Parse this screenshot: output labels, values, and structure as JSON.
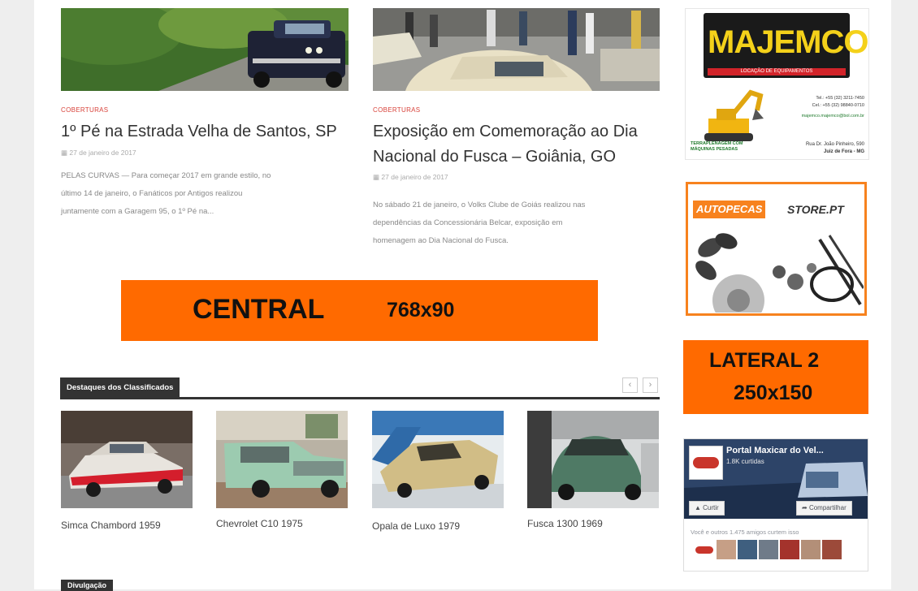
{
  "posts": [
    {
      "category": "COBERTURAS",
      "title": "1º Pé na Estrada Velha de Santos, SP",
      "date": "27 de janeiro de 2017",
      "excerpt_lines": [
        "PELAS CURVAS — Para começar 2017 em grande estilo, no",
        "último 14 de janeiro, o Fanáticos por Antigos realizou",
        "juntamente com a Garagem 95, o 1º Pé na..."
      ]
    },
    {
      "category": "COBERTURAS",
      "title_lines": [
        "Exposição em Comemoração ao Dia",
        "Nacional do Fusca – Goiânia, GO"
      ],
      "date": "27 de janeiro de 2017",
      "excerpt_lines": [
        "No sábado 21 de janeiro, o Volks Clube de Goiás realizou nas",
        "dependências da Concessionária Belcar, exposição em",
        "homenagem ao Dia Nacional do Fusca."
      ]
    }
  ],
  "central_banner": {
    "label": "CENTRAL",
    "size": "768x90"
  },
  "classifieds": {
    "heading": "Destaques dos Classificados",
    "prev_icon": "‹",
    "next_icon": "›",
    "items": [
      {
        "caption": "Simca Chambord 1959"
      },
      {
        "caption": "Chevrolet C10 1975"
      },
      {
        "caption": "Opala de Luxo 1979"
      },
      {
        "caption": "Fusca 1300 1969"
      }
    ]
  },
  "next_section": {
    "heading": "Divulgação"
  },
  "sidebar": {
    "majemco": {
      "brand": "MAJEMCO",
      "tagline": "LOCAÇÃO DE EQUIPAMENTOS",
      "phone1": "Tel.: +55 (32) 3211-7450",
      "phone2": "Cel.: +55 (32) 98840-0710",
      "email": "majemco.majemco@bol.com.br",
      "address": "Rua Dr. João Pinheiro, 590",
      "city": "Juiz de Fora - MG",
      "service": "TERRAPLENAGEM COM MÁQUINAS PESADAS"
    },
    "autopecas": {
      "brand_left": "AUTOPECAS",
      "brand_right": "STORE.PT"
    },
    "lateral_banner": {
      "label": "LATERAL 2",
      "size": "250x150"
    },
    "facebook": {
      "page_name": "Portal Maxicar do Vel...",
      "likes": "1.8K curtidas",
      "like_button": "Curtir",
      "share_button": "Compartilhar",
      "friends_text": "Você e outros 1.475 amigos curtem isso"
    }
  }
}
